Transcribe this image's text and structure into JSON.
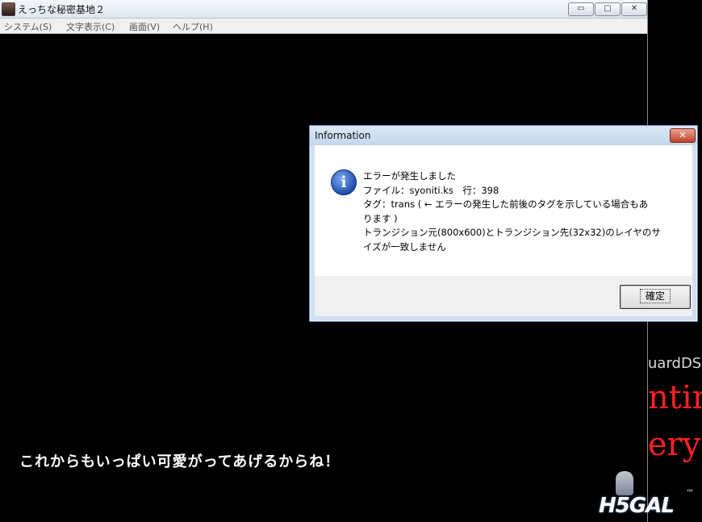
{
  "window": {
    "title": "えっちな秘密基地２",
    "controls": {
      "minimize": "▭",
      "maximize": "▢",
      "close": "✕"
    },
    "menu": [
      "システム(S)",
      "文字表示(C)",
      "画面(V)",
      "ヘルプ(H)"
    ]
  },
  "game": {
    "dialogue": "これからもいっぱい可愛がってあげるからね！"
  },
  "dialog": {
    "title": "Information",
    "close_symbol": "✕",
    "icon": "info-icon",
    "icon_glyph": "i",
    "message_lines": [
      "エラーが発生しました",
      "ファイル：syoniti.ks　行：398",
      "タグ：trans ( ← エラーの発生した前後のタグを示している場合もあ",
      "ります )",
      "トランジション元(800x600)とトランジション先(32x32)のレイヤのサ",
      "イズが一致しません"
    ],
    "ok_label": "確定"
  },
  "background_fragments": {
    "line1": "uardDSO",
    "line2": "ntin",
    "line3": "ery"
  },
  "watermark": {
    "logo": "H5GAL",
    "tm": "™"
  }
}
